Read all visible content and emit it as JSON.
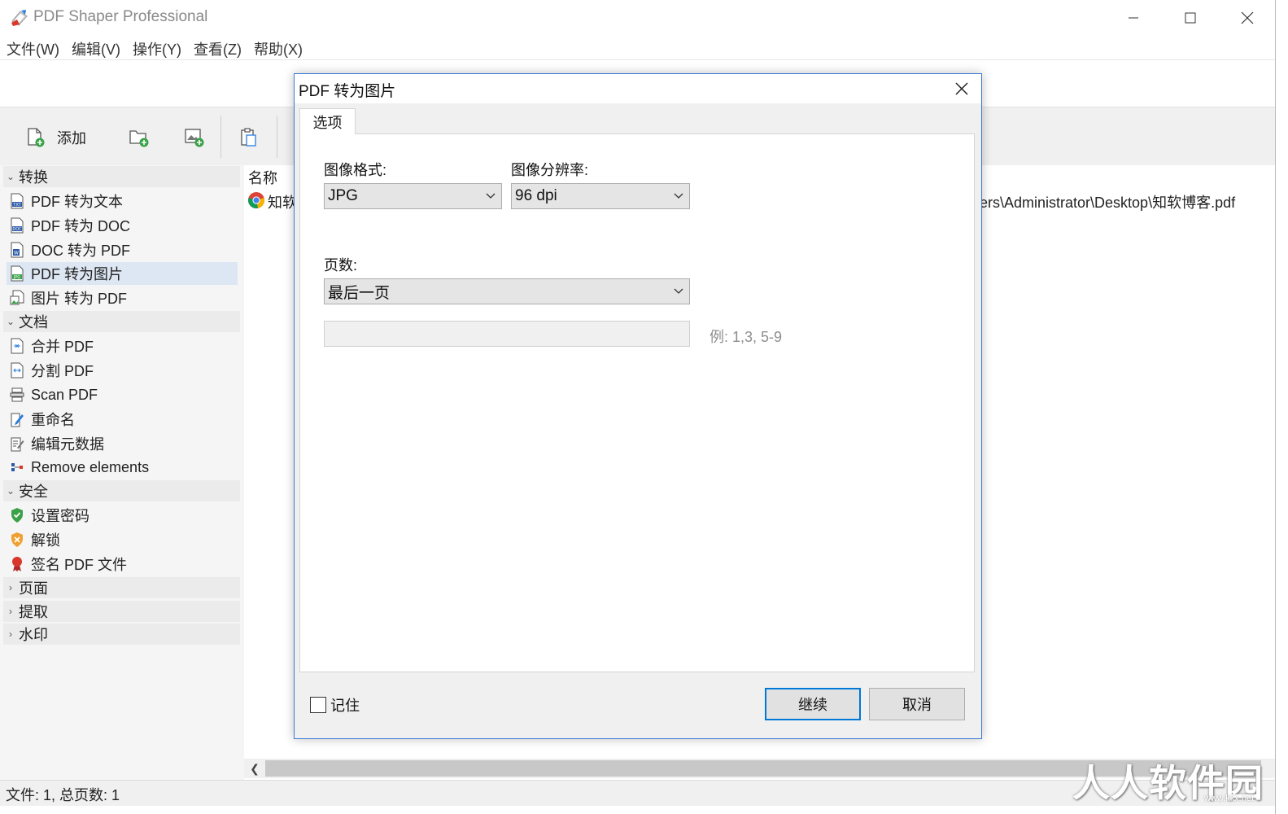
{
  "window": {
    "title": "PDF Shaper Professional",
    "controls": {
      "minimize": "—",
      "maximize": "☐",
      "close": "✕"
    }
  },
  "menu": [
    "文件(W)",
    "编辑(V)",
    "操作(Y)",
    "查看(Z)",
    "帮助(X)"
  ],
  "toolbar": {
    "add_label": "添加",
    "buttons": [
      "add-file-icon",
      "add-folder-icon",
      "add-image-icon",
      "paste-icon"
    ]
  },
  "sidebar": {
    "groups": [
      {
        "label": "转换",
        "expanded": true,
        "items": [
          {
            "label": "PDF 转为文本",
            "icon": "txt-file-icon"
          },
          {
            "label": "PDF 转为 DOC",
            "icon": "doc-file-icon"
          },
          {
            "label": "DOC 转为 PDF",
            "icon": "word-file-icon"
          },
          {
            "label": "PDF 转为图片",
            "icon": "jpg-file-icon",
            "selected": true
          },
          {
            "label": "图片 转为 PDF",
            "icon": "image-file-icon"
          }
        ]
      },
      {
        "label": "文档",
        "expanded": true,
        "items": [
          {
            "label": "合并 PDF",
            "icon": "merge-icon"
          },
          {
            "label": "分割 PDF",
            "icon": "split-icon"
          },
          {
            "label": "Scan PDF",
            "icon": "scan-icon"
          },
          {
            "label": "重命名",
            "icon": "rename-icon"
          },
          {
            "label": "编辑元数据",
            "icon": "metadata-icon"
          },
          {
            "label": "Remove elements",
            "icon": "remove-elements-icon"
          }
        ]
      },
      {
        "label": "安全",
        "expanded": true,
        "items": [
          {
            "label": "设置密码",
            "icon": "shield-check-icon"
          },
          {
            "label": "解锁",
            "icon": "shield-unlock-icon"
          },
          {
            "label": "签名 PDF 文件",
            "icon": "signature-ribbon-icon"
          }
        ]
      },
      {
        "label": "页面",
        "expanded": false
      },
      {
        "label": "提取",
        "expanded": false
      },
      {
        "label": "水印",
        "expanded": false
      }
    ]
  },
  "file_list": {
    "header": "名称",
    "rows": [
      {
        "name": "知软",
        "path": "ers\\Administrator\\Desktop\\知软博客.pdf",
        "icon": "chrome-icon"
      }
    ]
  },
  "status": {
    "text": "文件: 1, 总页数: 1"
  },
  "watermark": {
    "text": "人人软件园",
    "sub": "www.kkx.net"
  },
  "dialog": {
    "title": "PDF 转为图片",
    "tab": "选项",
    "format_label": "图像格式:",
    "format_value": "JPG",
    "resolution_label": "图像分辨率:",
    "resolution_value": "96 dpi",
    "pages_label": "页数:",
    "pages_value": "最后一页",
    "range_value": "",
    "range_hint": "例: 1,3, 5-9",
    "remember_label": "记住",
    "remember_checked": false,
    "continue_label": "继续",
    "cancel_label": "取消"
  },
  "colors": {
    "accent": "#0078d7",
    "dialog_border": "#3a7bd5",
    "selection": "#dde6f3"
  }
}
